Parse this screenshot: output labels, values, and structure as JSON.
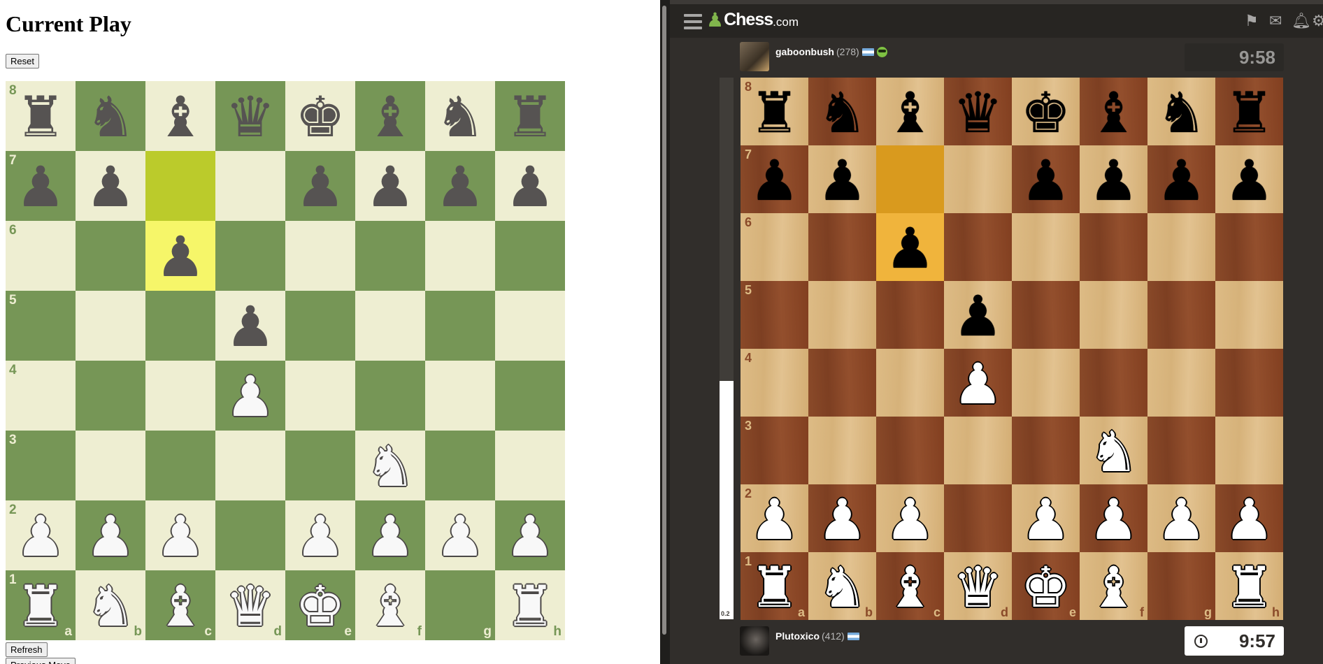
{
  "left_app": {
    "title": "Current Play",
    "reset_label": "Reset",
    "refresh_label": "Refresh",
    "previous_move_label": "Previous Move",
    "colors": {
      "light": "#eeeed2",
      "dark": "#769656",
      "highlight_from": "#bbcb2b",
      "highlight_to": "#f6f669"
    },
    "highlight": {
      "from": "c7",
      "to": "c6"
    }
  },
  "position": {
    "ranks": [
      [
        "r",
        "n",
        "b",
        "q",
        "k",
        "b",
        "n",
        "r"
      ],
      [
        "p",
        "p",
        "",
        "",
        "p",
        "p",
        "p",
        "p"
      ],
      [
        "",
        "",
        "p",
        "",
        "",
        "",
        "",
        ""
      ],
      [
        "",
        "",
        "",
        "p",
        "",
        "",
        "",
        ""
      ],
      [
        "",
        "",
        "",
        "P",
        "",
        "",
        "",
        ""
      ],
      [
        "",
        "",
        "",
        "",
        "",
        "N",
        "",
        ""
      ],
      [
        "P",
        "P",
        "P",
        "",
        "P",
        "P",
        "P",
        "P"
      ],
      [
        "R",
        "N",
        "B",
        "Q",
        "K",
        "B",
        "",
        "R"
      ]
    ],
    "files": [
      "a",
      "b",
      "c",
      "d",
      "e",
      "f",
      "g",
      "h"
    ],
    "rank_labels": [
      "8",
      "7",
      "6",
      "5",
      "4",
      "3",
      "2",
      "1"
    ]
  },
  "right_app": {
    "logo_text": "Chess",
    "logo_suffix": ".com",
    "top_icons": [
      "puzzle-icon",
      "mail-icon",
      "bell-icon",
      "settings-icon"
    ],
    "opponent": {
      "name": "gaboonbush",
      "rating": "(278)",
      "clock": "9:58"
    },
    "player": {
      "name": "Plutoxico",
      "rating": "(412)",
      "clock": "9:57"
    },
    "eval": {
      "score": "0.2",
      "white_fraction": 0.44
    },
    "highlight": {
      "from": "c7",
      "to": "c6"
    }
  }
}
